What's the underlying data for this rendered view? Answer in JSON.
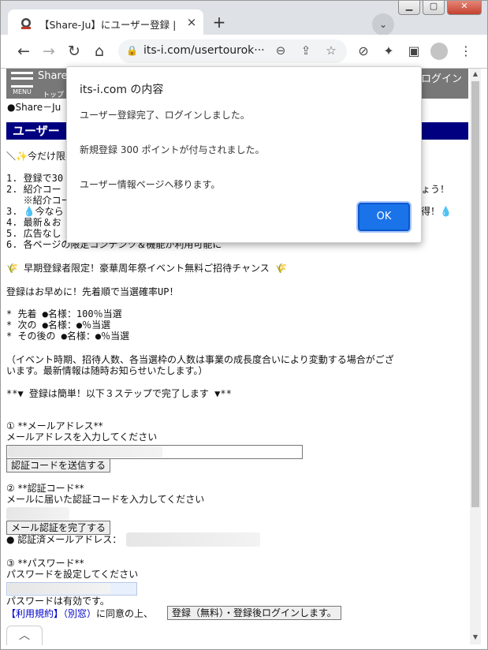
{
  "browser": {
    "tab_title": "【Share-Ju】にユーザー登録 |",
    "tab_close": "×",
    "new_tab": "+",
    "tab_search": "⌄",
    "window_buttons": {
      "minimize": "▁",
      "maximize": "▢",
      "close": "✕"
    },
    "url": "its-i.com/usertourok···",
    "nav": {
      "back": "←",
      "forward": "→",
      "reload": "↻",
      "home": "⌂"
    },
    "omnibox_icons": {
      "lock": "🔒",
      "zoom": "⊖",
      "share": "⇪",
      "bookmark": "☆"
    },
    "toolbar_icons": {
      "extension_a": "⊘",
      "extensions": "✦",
      "sidepanel": "▣",
      "menu": "⋮"
    }
  },
  "site": {
    "menu_label": "MENU",
    "name": "Share",
    "top_link": "トップ",
    "login_link": "ログイン",
    "breadcrumb": "●Share－Ju",
    "banner": "ユーザー"
  },
  "body": {
    "lead": "＼✨今だけ限",
    "list": [
      "1. 登録で30",
      "2. 紹介コー",
      "   ※紹介コー",
      "3. 💧今なら",
      "4. 最新＆お",
      "5. 広告なし",
      "6. 各ページの限定コンテンツ＆機能が利用可能に"
    ],
    "list_tail_2": "ょう！",
    "list_tail_3": "得！💧",
    "event": "🌾 早期登録者限定！豪華周年祭イベント無料ご招待チャンス 🌾",
    "hurry": "登録はお早めに！先着順で当選確率UP！",
    "odds": [
      "* 先着 ●名様：100％当選",
      "* 次の ●名様：●％当選",
      "* その後の ●名様：●％当選"
    ],
    "note1": "（イベント時期、招待人数、各当選枠の人数は事業の成長度合いにより変動する場合がござ",
    "note2": "います。最新情報は随時お知らせいたします。）",
    "steps": "**▼ 登録は簡単！以下３ステップで完了します ▼**",
    "step1_title": "① **メールアドレス**",
    "step1_desc": "メールアドレスを入力してください",
    "step1_button": "認証コードを送信する",
    "step2_title": "② **認証コード**",
    "step2_desc": "メールに届いた認証コードを入力してください",
    "step2_button": "メール認証を完了する",
    "verified_label": "● 認証済メールアドレス：",
    "step3_title": "③ **パスワード**",
    "step3_desc": "パスワードを設定してください",
    "password_status": "パスワードは有効です。",
    "terms_link": "【利用規約】（別窓）",
    "agree_text": "に同意の上、",
    "register_button": "登録（無料）・登録後ログインします。",
    "scroll_top": "︿"
  },
  "dialog": {
    "title": "its-i.com の内容",
    "line1": "ユーザー登録完了、ログインしました。",
    "line2": "新規登録 300 ポイントが付与されました。",
    "line3": "ユーザー情報ページへ移ります。",
    "ok": "OK"
  }
}
